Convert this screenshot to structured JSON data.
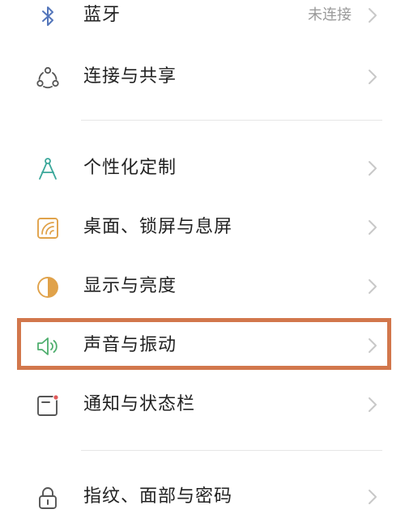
{
  "rows": [
    {
      "label": "蓝牙",
      "value": "未连接",
      "icon": "bluetooth-icon"
    },
    {
      "label": "连接与共享",
      "icon": "connection-share-icon"
    },
    {
      "label": "个性化定制",
      "icon": "personalization-icon"
    },
    {
      "label": "桌面、锁屏与息屏",
      "icon": "wallpaper-icon"
    },
    {
      "label": "显示与亮度",
      "icon": "brightness-icon"
    },
    {
      "label": "声音与振动",
      "icon": "speaker-icon"
    },
    {
      "label": "通知与状态栏",
      "icon": "notification-icon"
    },
    {
      "label": "指纹、面部与密码",
      "icon": "lock-icon"
    }
  ],
  "highlighted_row": "声音与振动",
  "colors": {
    "highlight_border": "#d2774c",
    "icon_blue": "#5577bb",
    "icon_teal": "#3aa79a",
    "icon_orange": "#e0a24a",
    "icon_green": "#4fae6e",
    "icon_gray": "#555555",
    "notification_dot": "#e05a5a"
  }
}
